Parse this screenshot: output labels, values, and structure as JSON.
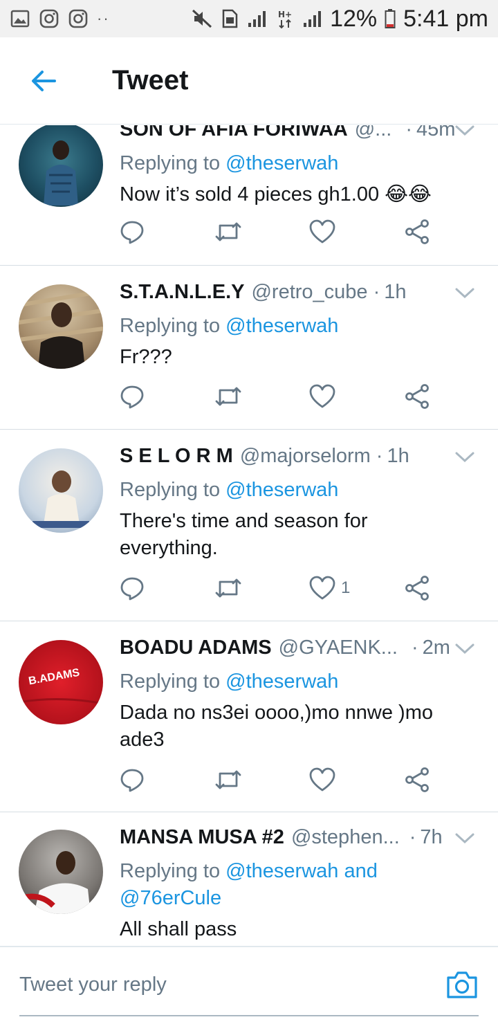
{
  "status_bar": {
    "battery": "12%",
    "time": "5:41 pm",
    "dots": "··"
  },
  "app_bar": {
    "title": "Tweet"
  },
  "tweets": [
    {
      "name": "SON OF AFIA FORIWAA",
      "handle": "@...",
      "time": "45m",
      "replying_prefix": "Replying to",
      "replying_to": "@theserwah",
      "text": "Now it’s sold 4 pieces gh1.00 😂😂",
      "like_count": ""
    },
    {
      "name": "S.T.A.N.L.E.Y",
      "handle": "@retro_cube",
      "time": "1h",
      "replying_prefix": "Replying to",
      "replying_to": "@theserwah",
      "text": "Fr???",
      "like_count": ""
    },
    {
      "name": "S E L O R M",
      "handle": "@majorselorm",
      "time": "1h",
      "replying_prefix": "Replying to",
      "replying_to": "@theserwah",
      "text": "There's time and season for everything.",
      "like_count": "1"
    },
    {
      "name": "BOADU ADAMS",
      "handle": "@GYAENK...",
      "time": "2m",
      "replying_prefix": "Replying to",
      "replying_to": "@theserwah",
      "text": "Dada no ns3ei oooo,)mo nnwe )mo ade3",
      "like_count": "",
      "avatar_text": "B.ADAMS"
    },
    {
      "name": "MANSA MUSA #2",
      "handle": "@stephen...",
      "time": "7h",
      "replying_prefix": "Replying to",
      "replying_to": "@theserwah and @76erCule",
      "text": "All shall pass",
      "like_count": ""
    }
  ],
  "compose": {
    "placeholder": "Tweet your reply"
  },
  "colors": {
    "accent": "#1b95e0",
    "muted": "#657786",
    "text": "#14171a"
  }
}
